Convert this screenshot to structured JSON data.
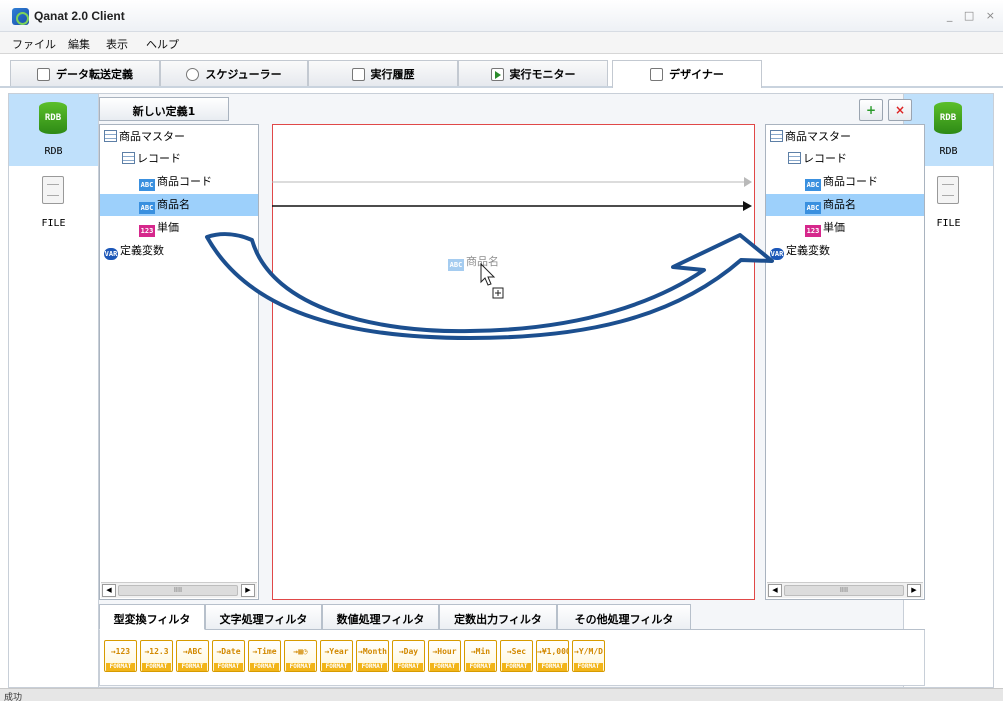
{
  "window": {
    "title": "Qanat 2.0 Client",
    "controls": "_ □ ×"
  },
  "menu": [
    {
      "label": "ファイル"
    },
    {
      "label": "編集"
    },
    {
      "label": "表示"
    },
    {
      "label": "ヘルプ"
    }
  ],
  "main_tabs": [
    {
      "label": "データ転送定義",
      "icon": "document-icon"
    },
    {
      "label": "スケジューラー",
      "icon": "clock-icon"
    },
    {
      "label": "実行履歴",
      "icon": "history-icon"
    },
    {
      "label": "実行モニター",
      "icon": "play-icon"
    },
    {
      "label": "デザイナー",
      "icon": "designer-icon",
      "active": true
    }
  ],
  "left_sidebar": [
    {
      "label": "RDB",
      "icon_text": "RDB",
      "selected": true
    },
    {
      "label": "FILE"
    }
  ],
  "right_sidebar": [
    {
      "label": "RDB",
      "icon_text": "RDB",
      "selected": true
    },
    {
      "label": "FILE"
    }
  ],
  "definition_tab": {
    "label": "新しい定義1"
  },
  "source_tree": [
    {
      "label": "商品マスター",
      "icon": "table",
      "icon_text": ""
    },
    {
      "label": "レコード",
      "icon": "table",
      "icon_text": ""
    },
    {
      "label": "商品コード",
      "icon": "abc",
      "icon_text": "ABC"
    },
    {
      "label": "商品名",
      "icon": "abc",
      "icon_text": "ABC",
      "selected": true
    },
    {
      "label": "単価",
      "icon": "num",
      "icon_text": "123"
    },
    {
      "label": "定義変数",
      "icon": "var",
      "icon_text": "VAR"
    }
  ],
  "target_tree": [
    {
      "label": "商品マスター",
      "icon": "table",
      "icon_text": ""
    },
    {
      "label": "レコード",
      "icon": "table",
      "icon_text": ""
    },
    {
      "label": "商品コード",
      "icon": "abc",
      "icon_text": "ABC"
    },
    {
      "label": "商品名",
      "icon": "abc",
      "icon_text": "ABC",
      "selected": true
    },
    {
      "label": "単価",
      "icon": "num",
      "icon_text": "123"
    },
    {
      "label": "定義変数",
      "icon": "var",
      "icon_text": "VAR"
    }
  ],
  "drag_ghost": {
    "icon_text": "ABC",
    "label": "商品名"
  },
  "scrollbar": {
    "thumb_mark": "IIII",
    "left_arrow": "◀",
    "right_arrow": "▶"
  },
  "filter_tabs": [
    {
      "label": "型変換フィルタ",
      "active": true
    },
    {
      "label": "文字処理フィルタ"
    },
    {
      "label": "数値処理フィルタ"
    },
    {
      "label": "定数出力フィルタ"
    },
    {
      "label": "その他処理フィルタ"
    }
  ],
  "filters": [
    {
      "top": "→123",
      "fmt": "FORMAT"
    },
    {
      "top": "→12.3",
      "fmt": "FORMAT"
    },
    {
      "top": "→ABC",
      "fmt": "FORMAT"
    },
    {
      "top": "→Date",
      "fmt": "FORMAT"
    },
    {
      "top": "→Time",
      "fmt": "FORMAT"
    },
    {
      "top": "→▦◷",
      "fmt": "FORMAT"
    },
    {
      "top": "→Year",
      "fmt": "FORMAT"
    },
    {
      "top": "→Month",
      "fmt": "FORMAT"
    },
    {
      "top": "→Day",
      "fmt": "FORMAT"
    },
    {
      "top": "→Hour",
      "fmt": "FORMAT"
    },
    {
      "top": "→Min",
      "fmt": "FORMAT"
    },
    {
      "top": "→Sec",
      "fmt": "FORMAT"
    },
    {
      "top": "→¥1,000",
      "fmt": "FORMAT"
    },
    {
      "top": "→Y/M/D",
      "fmt": "FORMAT"
    }
  ],
  "status": {
    "text": "成功"
  },
  "colors": {
    "selection": "#9dd0fb",
    "sidebar_selection": "#bfe0fb",
    "mapping_border": "#e04848",
    "arrow": "#1c4f8f",
    "filter_accent": "#d79b00"
  }
}
